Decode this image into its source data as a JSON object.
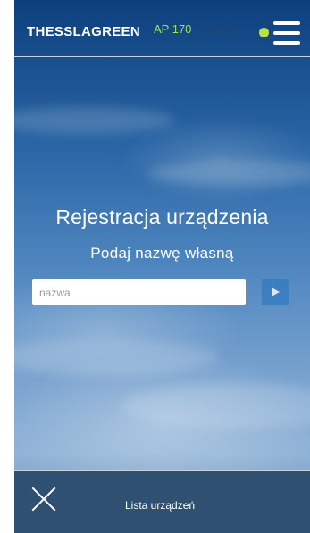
{
  "header": {
    "brand": "THESSLAGREEN",
    "model": "AP 170",
    "serial": "(1163)",
    "status_color": "#b8e04a",
    "menu_icon": "hamburger-menu-icon"
  },
  "main": {
    "title": "Rejestracja urządzenia",
    "subtitle": "Podaj nazwę własną",
    "name_input": {
      "value": "",
      "placeholder": "nazwa"
    },
    "submit_icon": "play-arrow-icon"
  },
  "footer": {
    "close_icon": "close-icon",
    "device_list_label": "Lista urządzeń"
  },
  "colors": {
    "accent_green": "#9be35a",
    "button_blue": "#3b7fc1"
  }
}
